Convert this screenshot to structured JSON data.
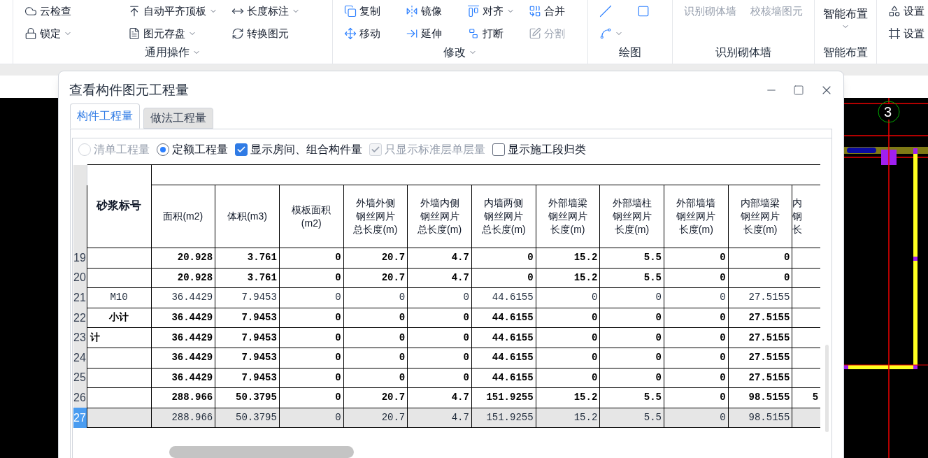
{
  "ribbon": {
    "groups": [
      {
        "label": "通用操作",
        "expandable": true,
        "items": [
          {
            "label": "云检查",
            "dropdown": false,
            "disabled": false
          },
          {
            "label": "自动平齐顶板",
            "dropdown": true,
            "disabled": false
          },
          {
            "label": "长度标注",
            "dropdown": true,
            "disabled": false
          },
          {
            "label": "锁定",
            "dropdown": true,
            "disabled": false
          },
          {
            "label": "图元存盘",
            "dropdown": true,
            "disabled": false
          },
          {
            "label": "转换图元",
            "dropdown": false,
            "disabled": false
          }
        ]
      },
      {
        "label": "修改",
        "expandable": true,
        "items": [
          {
            "label": "复制",
            "dropdown": false,
            "disabled": false
          },
          {
            "label": "镜像",
            "dropdown": false,
            "disabled": false
          },
          {
            "label": "对齐",
            "dropdown": true,
            "disabled": false
          },
          {
            "label": "合并",
            "dropdown": false,
            "disabled": false
          },
          {
            "label": "移动",
            "dropdown": false,
            "disabled": false
          },
          {
            "label": "延伸",
            "dropdown": false,
            "disabled": false
          },
          {
            "label": "打断",
            "dropdown": false,
            "disabled": false
          },
          {
            "label": "分割",
            "dropdown": false,
            "disabled": true
          }
        ]
      },
      {
        "label": "绘图",
        "expandable": false,
        "items": [
          {
            "dropdown": false,
            "disabled": false
          },
          {
            "dropdown": false,
            "disabled": false
          },
          {
            "dropdown": true,
            "disabled": false
          }
        ]
      },
      {
        "label": "识别砌体墙",
        "expandable": false,
        "items": [
          {
            "label": "识别砌体墙",
            "dropdown": false,
            "disabled": true
          },
          {
            "label": "校核墙图元",
            "dropdown": false,
            "disabled": true
          }
        ]
      },
      {
        "label": "智能布置",
        "expandable": false,
        "items": [
          {
            "label": "智能布置",
            "dropdown": true,
            "disabled": false
          }
        ]
      },
      {
        "items": [
          {
            "label": "设置",
            "disabled": false
          },
          {
            "label": "设置",
            "disabled": false
          }
        ]
      }
    ]
  },
  "cad": {
    "axis_label": "3"
  },
  "dialog": {
    "title": "查看构件图元工程量",
    "tabs": [
      {
        "label": "构件工程量",
        "selected": true
      },
      {
        "label": "做法工程量",
        "selected": false
      }
    ],
    "options": [
      {
        "kind": "radio",
        "label": "清单工程量",
        "selected": false,
        "disabled": true
      },
      {
        "kind": "radio",
        "label": "定额工程量",
        "selected": true,
        "disabled": false
      },
      {
        "kind": "checkbox",
        "label": "显示房间、组合构件量",
        "checked": true,
        "disabled": false
      },
      {
        "kind": "checkbox",
        "label": "只显示标准层单层量",
        "checked": true,
        "disabled": true
      },
      {
        "kind": "checkbox",
        "label": "显示施工段归类",
        "checked": false,
        "disabled": false
      }
    ],
    "table": {
      "label_column": "砂浆标号",
      "columns": [
        "面积(m2)",
        "体积(m3)",
        "模板面积(m2)",
        "外墙外侧钢丝网片总长度(m)",
        "外墙内侧钢丝网片总长度(m)",
        "内墙两侧钢丝网片总长度(m)",
        "外部墙梁钢丝网片长度(m)",
        "外部墙柱钢丝网片长度(m)",
        "外部墙墙钢丝网片长度(m)",
        "内部墙梁钢丝网片长度(m)",
        "内钢长"
      ],
      "rows": [
        {
          "number": "19",
          "label": "",
          "bold": true,
          "selected": false,
          "values": [
            "20.928",
            "3.761",
            "0",
            "20.7",
            "4.7",
            "0",
            "15.2",
            "5.5",
            "0",
            "0"
          ]
        },
        {
          "number": "20",
          "label": "",
          "bold": true,
          "selected": false,
          "values": [
            "20.928",
            "3.761",
            "0",
            "20.7",
            "4.7",
            "0",
            "15.2",
            "5.5",
            "0",
            "0"
          ]
        },
        {
          "number": "21",
          "label": "M10",
          "bold": false,
          "selected": false,
          "values": [
            "36.4429",
            "7.9453",
            "0",
            "0",
            "0",
            "44.6155",
            "0",
            "0",
            "0",
            "27.5155"
          ]
        },
        {
          "number": "22",
          "label": "小计",
          "bold": true,
          "selected": false,
          "values": [
            "36.4429",
            "7.9453",
            "0",
            "0",
            "0",
            "44.6155",
            "0",
            "0",
            "0",
            "27.5155"
          ]
        },
        {
          "number": "23",
          "label": "计",
          "bold": true,
          "selected": false,
          "values": [
            "36.4429",
            "7.9453",
            "0",
            "0",
            "0",
            "44.6155",
            "0",
            "0",
            "0",
            "27.5155"
          ]
        },
        {
          "number": "24",
          "label": "",
          "bold": true,
          "selected": false,
          "values": [
            "36.4429",
            "7.9453",
            "0",
            "0",
            "0",
            "44.6155",
            "0",
            "0",
            "0",
            "27.5155"
          ]
        },
        {
          "number": "25",
          "label": "",
          "bold": true,
          "selected": false,
          "values": [
            "36.4429",
            "7.9453",
            "0",
            "0",
            "0",
            "44.6155",
            "0",
            "0",
            "0",
            "27.5155"
          ]
        },
        {
          "number": "26",
          "label": "",
          "bold": true,
          "selected": false,
          "values": [
            "288.966",
            "50.3795",
            "0",
            "20.7",
            "4.7",
            "151.9255",
            "15.2",
            "5.5",
            "0",
            "98.5155",
            "5"
          ]
        },
        {
          "number": "27",
          "label": "",
          "bold": false,
          "selected": true,
          "values": [
            "288.966",
            "50.3795",
            "0",
            "20.7",
            "4.7",
            "151.9255",
            "15.2",
            "5.5",
            "0",
            "98.5155"
          ]
        }
      ]
    }
  }
}
